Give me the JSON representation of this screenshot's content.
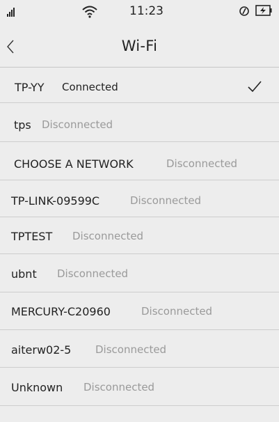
{
  "status_bar": {
    "time": "11:23",
    "icons": [
      "signal-icon",
      "wifi-icon",
      "alarm-icon",
      "battery-charging-icon"
    ]
  },
  "header": {
    "title": "Wi-Fi",
    "back_icon": "chevron-left-icon"
  },
  "networks": [
    {
      "name": "TP-YY",
      "status": "Connected",
      "selected": true
    },
    {
      "name": "tps",
      "status": "Disconnected"
    },
    {
      "name": "CHOOSE A NETWORK",
      "status": "Disconnected"
    },
    {
      "name": "TP-LINK-09599C",
      "status": "Disconnected"
    },
    {
      "name": "TPTEST",
      "status": "Disconnected"
    },
    {
      "name": "ubnt",
      "status": "Disconnected"
    },
    {
      "name": "MERCURY-C20960",
      "status": "Disconnected"
    },
    {
      "name": "aiterw02-5",
      "status": "Disconnected"
    },
    {
      "name": "Unknown",
      "status": "Disconnected"
    }
  ],
  "colors": {
    "background": "#ededed",
    "divider": "#cdcdcd",
    "secondary_text": "#9a9a9a"
  }
}
